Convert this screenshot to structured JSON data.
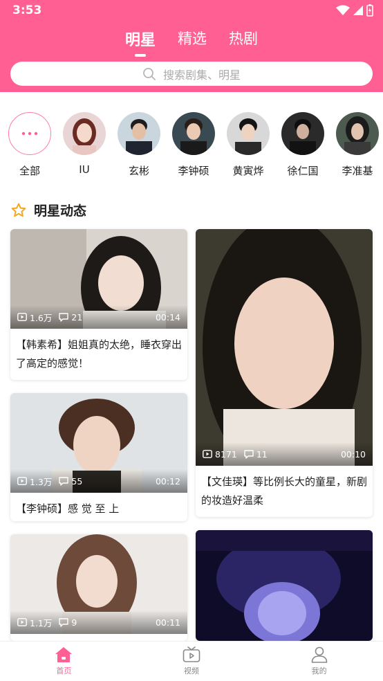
{
  "status": {
    "time": "3:53"
  },
  "tabs": [
    {
      "label": "明星",
      "active": true
    },
    {
      "label": "精选",
      "active": false
    },
    {
      "label": "热剧",
      "active": false
    }
  ],
  "search": {
    "placeholder": "搜索剧集、明星"
  },
  "stars": [
    {
      "name": "全部",
      "icon": "more-dots-icon"
    },
    {
      "name": "IU"
    },
    {
      "name": "玄彬"
    },
    {
      "name": "李钟硕"
    },
    {
      "name": "黄寅烨"
    },
    {
      "name": "徐仁国"
    },
    {
      "name": "李准基"
    }
  ],
  "section": {
    "title": "明星动态",
    "icon": "star-icon"
  },
  "cards": [
    {
      "views": "1.6万",
      "comments": "21",
      "duration": "00:14",
      "caption": "【韩素希】姐姐真的太绝，睡衣穿出了高定的感觉！"
    },
    {
      "views": "8171",
      "comments": "11",
      "duration": "00:10",
      "caption": "【文佳瑛】等比例长大的童星，新剧的妆造好温柔"
    },
    {
      "views": "1.3万",
      "comments": "55",
      "duration": "00:12",
      "caption": "【李钟硕】感 觉 至 上"
    },
    {
      "views": "1.1万",
      "comments": "9",
      "duration": "00:11",
      "caption": ""
    }
  ],
  "nav": [
    {
      "label": "首页",
      "icon": "home-icon",
      "active": true
    },
    {
      "label": "视频",
      "icon": "video-tv-icon",
      "active": false
    },
    {
      "label": "我的",
      "icon": "profile-icon",
      "active": false
    }
  ],
  "colors": {
    "brand": "#ff5f92",
    "accent_star": "#f5a623"
  }
}
